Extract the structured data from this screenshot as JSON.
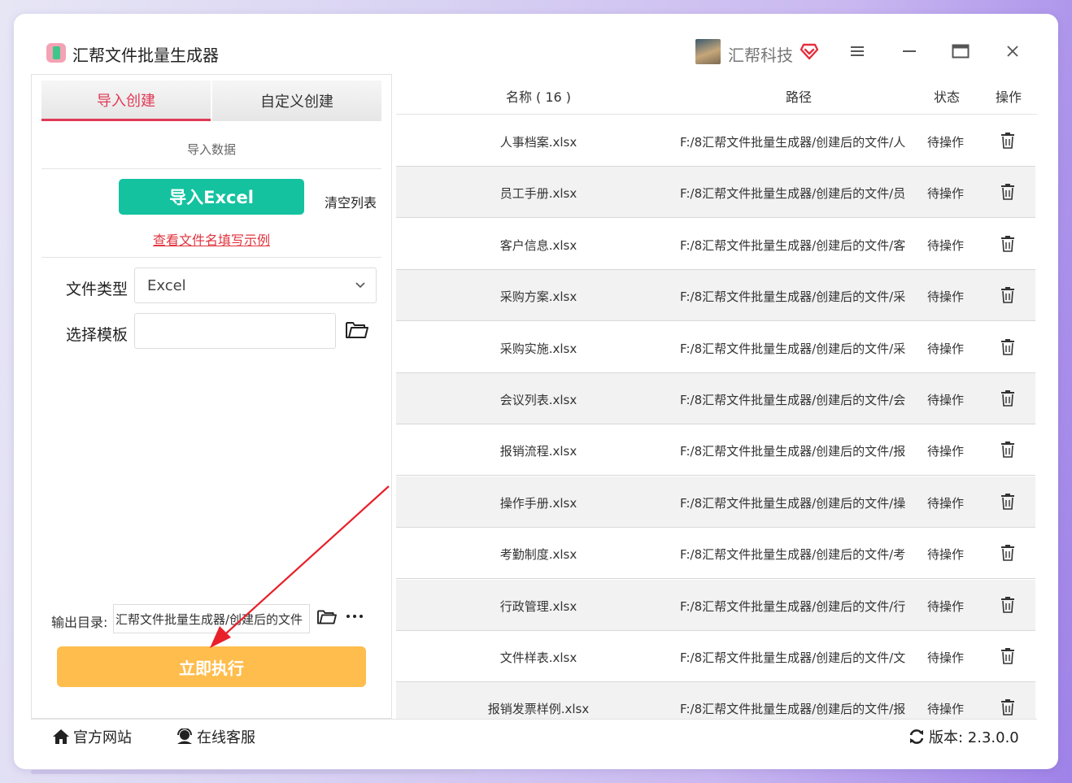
{
  "window": {
    "title": "汇帮文件批量生成器",
    "brand_name": "汇帮科技"
  },
  "tabs": [
    {
      "label": "导入创建",
      "active": true
    },
    {
      "label": "自定义创建",
      "active": false
    }
  ],
  "left_panel": {
    "section_label": "导入数据",
    "import_button": "导入Excel",
    "clear_link": "清空列表",
    "example_link": "查看文件名填写示例",
    "file_type_label": "文件类型",
    "file_type_value": "Excel",
    "template_label": "选择模板",
    "template_value": "",
    "output_label": "输出目录:",
    "output_value": "汇帮文件批量生成器/创建后的文件",
    "run_button": "立即执行"
  },
  "table": {
    "headers": {
      "name": "名称 ( 16 )",
      "path": "路径",
      "status": "状态",
      "action": "操作"
    },
    "rows": [
      {
        "name": "人事档案.xlsx",
        "path": "F:/8汇帮文件批量生成器/创建后的文件/人",
        "status": "待操作"
      },
      {
        "name": "员工手册.xlsx",
        "path": "F:/8汇帮文件批量生成器/创建后的文件/员",
        "status": "待操作"
      },
      {
        "name": "客户信息.xlsx",
        "path": "F:/8汇帮文件批量生成器/创建后的文件/客",
        "status": "待操作"
      },
      {
        "name": "采购方案.xlsx",
        "path": "F:/8汇帮文件批量生成器/创建后的文件/采",
        "status": "待操作"
      },
      {
        "name": "采购实施.xlsx",
        "path": "F:/8汇帮文件批量生成器/创建后的文件/采",
        "status": "待操作"
      },
      {
        "name": "会议列表.xlsx",
        "path": "F:/8汇帮文件批量生成器/创建后的文件/会",
        "status": "待操作"
      },
      {
        "name": "报销流程.xlsx",
        "path": "F:/8汇帮文件批量生成器/创建后的文件/报",
        "status": "待操作"
      },
      {
        "name": "操作手册.xlsx",
        "path": "F:/8汇帮文件批量生成器/创建后的文件/操",
        "status": "待操作"
      },
      {
        "name": "考勤制度.xlsx",
        "path": "F:/8汇帮文件批量生成器/创建后的文件/考",
        "status": "待操作"
      },
      {
        "name": "行政管理.xlsx",
        "path": "F:/8汇帮文件批量生成器/创建后的文件/行",
        "status": "待操作"
      },
      {
        "name": "文件样表.xlsx",
        "path": "F:/8汇帮文件批量生成器/创建后的文件/文",
        "status": "待操作"
      },
      {
        "name": "报销发票样例.xlsx",
        "path": "F:/8汇帮文件批量生成器/创建后的文件/报",
        "status": "待操作"
      }
    ]
  },
  "footer": {
    "website": "官方网站",
    "support": "在线客服",
    "version": "版本: 2.3.0.0"
  },
  "colors": {
    "accent_red": "#e03a55",
    "import_green": "#14c2a0",
    "run_orange": "#ffbd4d",
    "arrow_red": "#e8202a"
  },
  "icons": [
    "app-icon",
    "vip-heart-icon",
    "menu-icon",
    "minimize-icon",
    "maximize-icon",
    "close-icon",
    "chevron-down-icon",
    "folder-icon",
    "more-icon",
    "trash-icon",
    "home-icon",
    "support-icon",
    "refresh-icon"
  ]
}
